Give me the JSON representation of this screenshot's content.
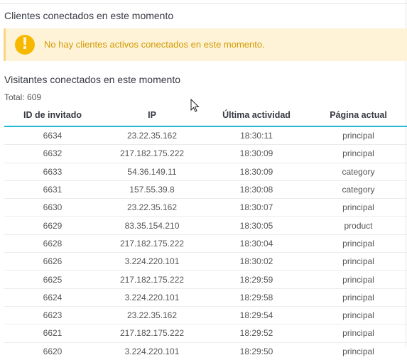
{
  "customers": {
    "title": "Clientes conectados en este momento",
    "alert_text": "No hay clientes activos conectados en este momento."
  },
  "visitors": {
    "title": "Visitantes conectados en este momento",
    "total": "Total: 609",
    "columns": [
      "ID de invitado",
      "IP",
      "Última actividad",
      "Página actual"
    ],
    "rows": [
      [
        "6634",
        "23.22.35.162",
        "18:30:11",
        "principal"
      ],
      [
        "6632",
        "217.182.175.222",
        "18:30:09",
        "principal"
      ],
      [
        "6633",
        "54.36.149.11",
        "18:30:09",
        "category"
      ],
      [
        "6631",
        "157.55.39.8",
        "18:30:08",
        "category"
      ],
      [
        "6630",
        "23.22.35.162",
        "18:30:07",
        "principal"
      ],
      [
        "6629",
        "83.35.154.210",
        "18:30:05",
        "product"
      ],
      [
        "6628",
        "217.182.175.222",
        "18:30:04",
        "principal"
      ],
      [
        "6626",
        "3.224.220.101",
        "18:30:02",
        "principal"
      ],
      [
        "6625",
        "217.182.175.222",
        "18:29:59",
        "principal"
      ],
      [
        "6624",
        "3.224.220.101",
        "18:29:58",
        "principal"
      ],
      [
        "6623",
        "23.22.35.162",
        "18:29:54",
        "principal"
      ],
      [
        "6621",
        "217.182.175.222",
        "18:29:52",
        "principal"
      ],
      [
        "6620",
        "3.224.220.101",
        "18:29:50",
        "principal"
      ]
    ]
  },
  "icons": {
    "alert": "exclamation-circle-icon",
    "cursor": "mouse-pointer-icon"
  },
  "colors": {
    "alert_bg": "#fff3d7",
    "alert_icon": "#f7b900",
    "alert_text": "#d19a00",
    "header_border": "#25b9d7"
  }
}
